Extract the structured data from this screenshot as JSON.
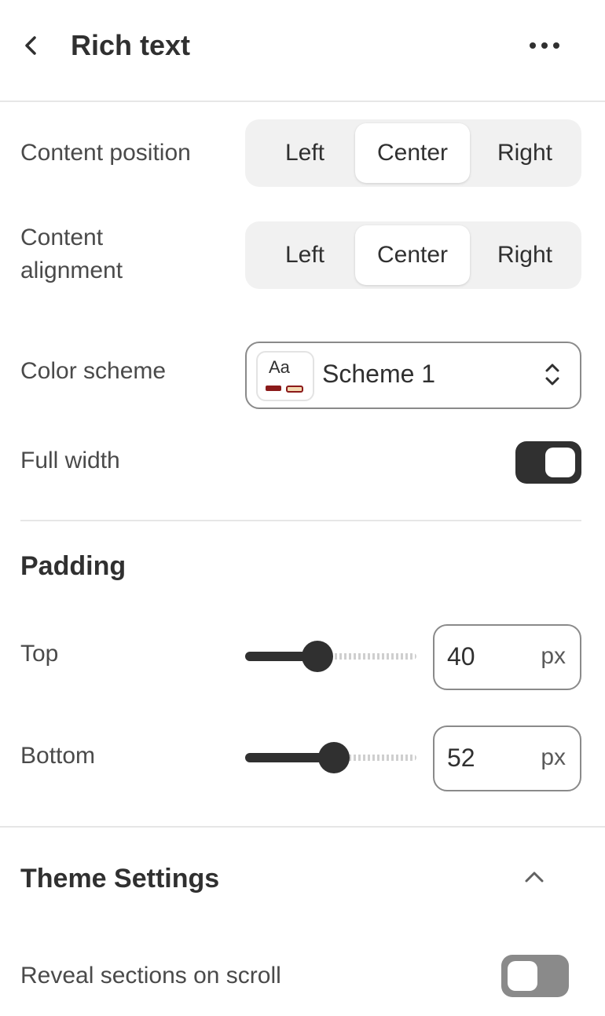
{
  "header": {
    "title": "Rich text"
  },
  "content_position": {
    "label": "Content position",
    "options": [
      "Left",
      "Center",
      "Right"
    ],
    "selected": "Center"
  },
  "content_alignment": {
    "label_line1": "Content",
    "label_line2": "alignment",
    "options": [
      "Left",
      "Center",
      "Right"
    ],
    "selected": "Center"
  },
  "color_scheme": {
    "label": "Color scheme",
    "swatch_text": "Aa",
    "value": "Scheme 1",
    "swatch_colors": {
      "primary": "#8b1a1a",
      "secondary": "#f3d9b1"
    }
  },
  "full_width": {
    "label": "Full width",
    "enabled": true
  },
  "padding": {
    "heading": "Padding",
    "top": {
      "label": "Top",
      "value": "40",
      "unit": "px",
      "slider_level": 0.42
    },
    "bottom": {
      "label": "Bottom",
      "value": "52",
      "unit": "px",
      "slider_level": 0.52
    }
  },
  "theme_settings": {
    "heading": "Theme Settings",
    "expanded": true,
    "reveal": {
      "label": "Reveal sections on scroll",
      "enabled": false
    }
  },
  "colors": {
    "text": "#303030",
    "toggle_on": "#303030",
    "toggle_off": "#8a8a8a"
  }
}
